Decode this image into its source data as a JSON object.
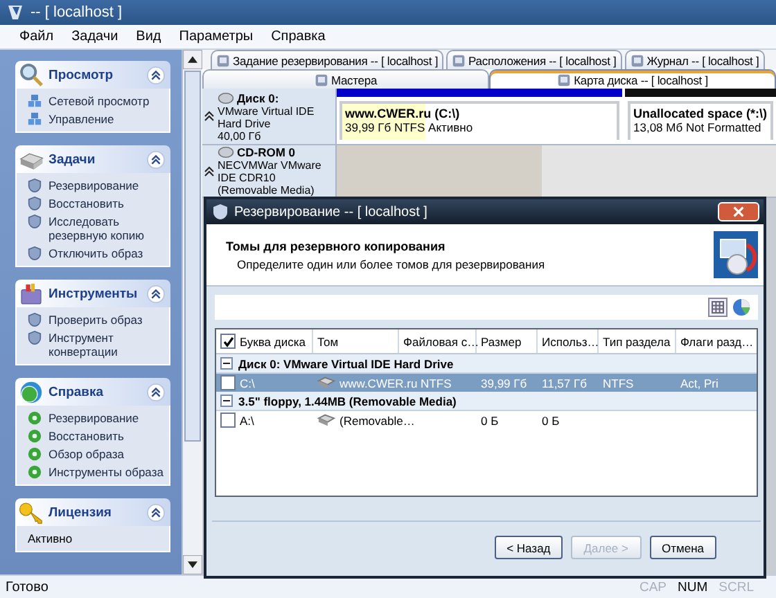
{
  "window": {
    "title": "-- [ localhost ]"
  },
  "menu": [
    "Файл",
    "Задачи",
    "Вид",
    "Параметры",
    "Справка"
  ],
  "sidebar": {
    "panels": [
      {
        "title": "Просмотр",
        "expanded": true,
        "items": [
          {
            "kind": "link",
            "label": "Сетевой просмотр"
          },
          {
            "kind": "link",
            "label": "Управление"
          }
        ]
      },
      {
        "title": "Задачи",
        "expanded": true,
        "items": [
          {
            "kind": "link",
            "label": "Резервирование"
          },
          {
            "kind": "link",
            "label": "Восстановить"
          },
          {
            "kind": "link",
            "label": "Исследовать резервную копию"
          },
          {
            "kind": "link",
            "label": "Отключить образ"
          }
        ]
      },
      {
        "title": "Инструменты",
        "expanded": true,
        "items": [
          {
            "kind": "link",
            "label": "Проверить образ"
          },
          {
            "kind": "link",
            "label": "Инструмент конвертации"
          }
        ]
      },
      {
        "title": "Справка",
        "expanded": true,
        "items": [
          {
            "kind": "link",
            "label": "Резервирование"
          },
          {
            "kind": "link",
            "label": "Восстановить"
          },
          {
            "kind": "link",
            "label": "Обзор образа"
          },
          {
            "kind": "link",
            "label": "Инструменты образа"
          }
        ]
      },
      {
        "title": "Лицензия",
        "expanded": true,
        "items": [
          {
            "kind": "text",
            "label": "Активно"
          }
        ]
      }
    ]
  },
  "tabs": {
    "rows": [
      [
        {
          "label": "Задание резервирования -- [ localhost ]",
          "selected": false
        },
        {
          "label": "Расположения -- [ localhost ]",
          "selected": false
        },
        {
          "label": "Журнал -- [ localhost ]",
          "selected": false
        }
      ],
      [
        {
          "label": "Мастера",
          "selected": false
        },
        {
          "label": "Карта диска -- [ localhost ]",
          "selected": true
        }
      ]
    ]
  },
  "disk_map": {
    "disks": [
      {
        "name": "Диск 0:",
        "description": "VMware Virtual IDE Hard Drive",
        "size": "40,00 Гб",
        "partitions": [
          {
            "label": "www.CWER.ru (C:\\)",
            "info": "39,99 Гб NTFS Активно",
            "color": "#0000c8",
            "selected": true
          },
          {
            "label": "Unallocated space (*:\\)",
            "info": "13,08 Мб Not Formatted",
            "color": "#101010",
            "selected": false
          }
        ]
      },
      {
        "name": "CD-ROM 0",
        "description": "NECVMWar VMware IDE CDR10 (Removable Media)"
      }
    ]
  },
  "dialog": {
    "title": "Резервирование -- [ localhost ]",
    "heading": "Томы для резервного копирования",
    "subtitle": "Определите один или более томов для резервирования",
    "select_all": {
      "checked": true
    },
    "columns": [
      "Буква диска",
      "Том",
      "Файловая с…",
      "Размер",
      "Использ…",
      "Тип раздела",
      "Флаги разд…"
    ],
    "groups": [
      {
        "title": "Диск 0: VMware Virtual IDE Hard Drive",
        "expanded": true,
        "rows": [
          {
            "checked": false,
            "selected": true,
            "letter": "C:\\",
            "volume": "www.CWER.ru NTFS",
            "size": "39,99 Гб",
            "used": "11,57 Гб",
            "type": "NTFS",
            "flags": "Act, Pri"
          }
        ]
      },
      {
        "title": "3.5\" floppy, 1.44MB (Removable Media)",
        "expanded": true,
        "rows": [
          {
            "checked": false,
            "selected": false,
            "letter": "A:\\",
            "volume": "(Removable…",
            "size": "0 Б",
            "used": "0 Б"
          }
        ]
      }
    ],
    "buttons": [
      {
        "label": "< Назад",
        "disabled": false
      },
      {
        "label": "Далее >",
        "disabled": true
      },
      {
        "label": "Отмена",
        "disabled": false
      }
    ]
  },
  "status_bar": {
    "text": "Готово",
    "indicators": [
      {
        "label": "CAP",
        "on": false
      },
      {
        "label": "NUM",
        "on": true
      },
      {
        "label": "SCRL",
        "on": false
      }
    ]
  }
}
